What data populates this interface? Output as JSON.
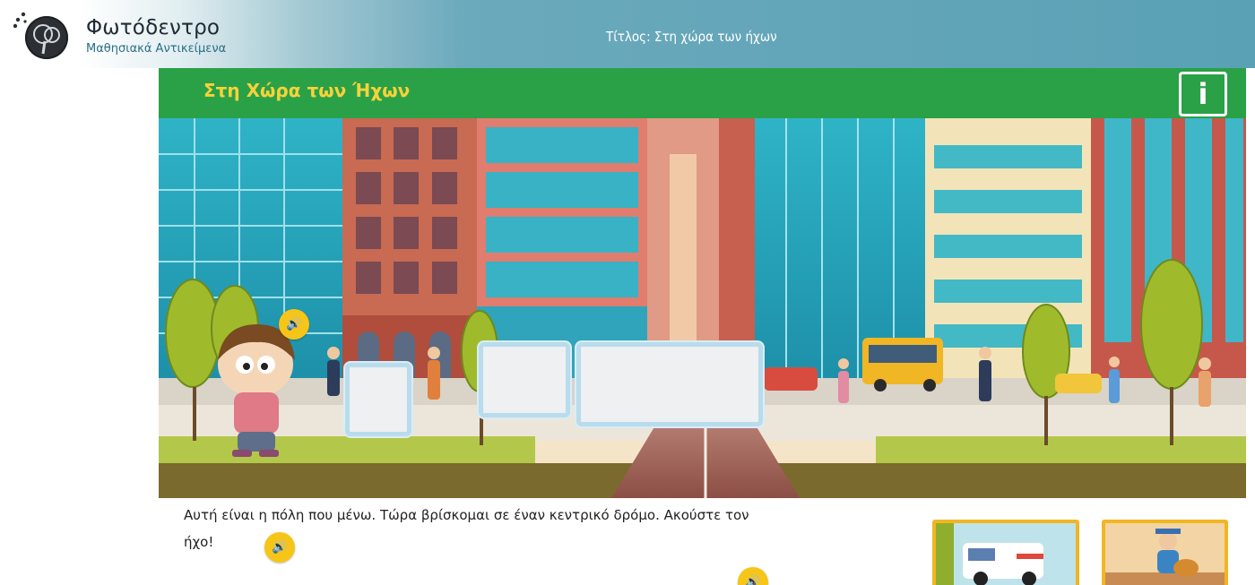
{
  "header": {
    "brand_name": "Φωτόδεντρο",
    "brand_subtitle": "Μαθησιακά Αντικείμενα",
    "document_title": "Τίτλος: Στη χώρα των ήχων",
    "colors": {
      "bar": "#5aa1b5",
      "brand_text": "#1f2a36",
      "subtitle": "#2a6e86"
    }
  },
  "lesson": {
    "title": "Στη Χώρα των Ήχων",
    "info_button_label": "i",
    "colors": {
      "bar": "#2aa147",
      "title": "#f7d23a",
      "sound_button": "#f6c518"
    }
  },
  "scene": {
    "description_icons": [
      "speaker-icon"
    ],
    "blank_cards": 3
  },
  "narration": {
    "line1": "Αυτή είναι η πόλη που μένω. Τώρα βρίσκομαι σε έναν κεντρικό δρόμο. Ακούστε τον",
    "line2": "ήχο!"
  },
  "icons": {
    "sound": "speaker-icon",
    "info": "info-icon"
  }
}
